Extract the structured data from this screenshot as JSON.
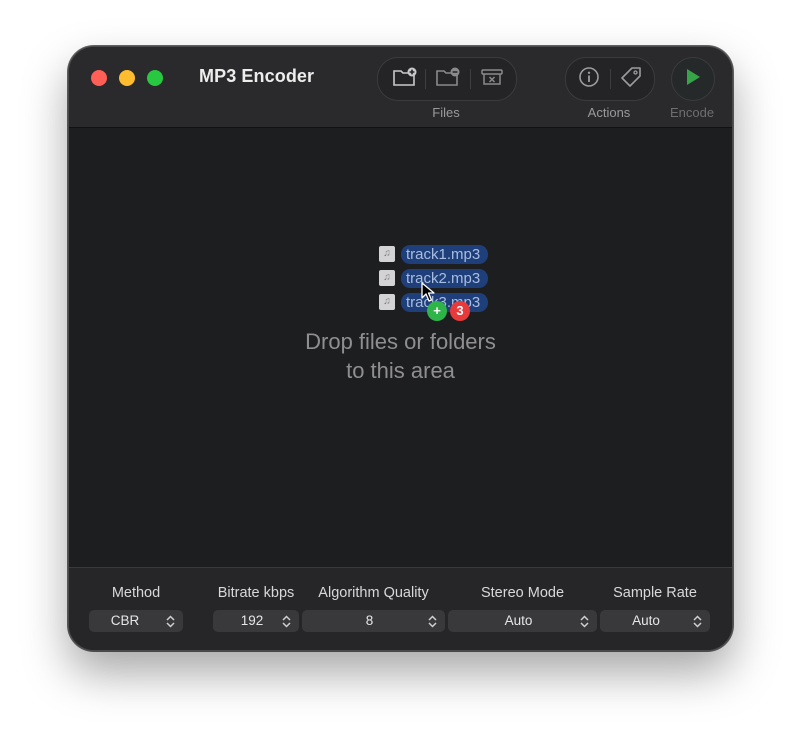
{
  "window": {
    "title": "MP3 Encoder"
  },
  "toolbar": {
    "groups": [
      {
        "label": "Files",
        "buttons": [
          "add-file-icon",
          "remove-file-icon",
          "clear-list-icon"
        ]
      },
      {
        "label": "Actions",
        "buttons": [
          "info-icon",
          "tag-icon"
        ]
      }
    ],
    "encode": {
      "label": "Encode",
      "icon": "play-icon"
    }
  },
  "drop_area": {
    "dragged_files": [
      "track1.mp3",
      "track2.mp3",
      "track3.mp3"
    ],
    "drag_count": "3",
    "add_badge": "+",
    "message_line1": "Drop files or folders",
    "message_line2": "to this area"
  },
  "options": [
    {
      "label": "Method",
      "value": "CBR"
    },
    {
      "label": "Bitrate kbps",
      "value": "192"
    },
    {
      "label": "Algorithm Quality",
      "value": "8"
    },
    {
      "label": "Stereo Mode",
      "value": "Auto"
    },
    {
      "label": "Sample Rate",
      "value": "Auto"
    }
  ],
  "colors": {
    "window_bg": "#1d1e20",
    "titlebar_bg": "#2a2a2c",
    "selection_blue": "#1e3f79",
    "add_badge_green": "#2fb44a",
    "count_badge_red": "#e83a3a",
    "encode_green": "#37a44a"
  }
}
